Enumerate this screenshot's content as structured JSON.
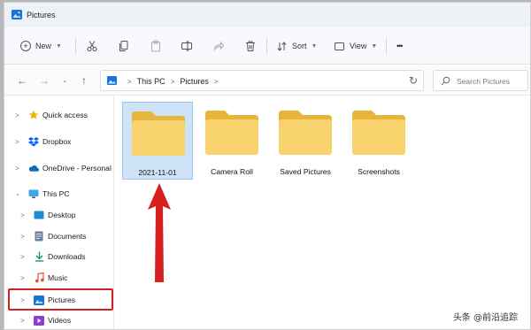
{
  "window": {
    "title": "Pictures"
  },
  "toolbar": {
    "new_label": "New",
    "sort_label": "Sort",
    "view_label": "View",
    "more_label": "•••"
  },
  "address": {
    "crumbs": [
      "This PC",
      "Pictures"
    ],
    "search_placeholder": "Search Pictures"
  },
  "nav": {
    "items": [
      {
        "label": "Quick access",
        "icon": "star-icon"
      },
      {
        "label": "Dropbox",
        "icon": "dropbox-icon"
      },
      {
        "label": "OneDrive - Personal",
        "icon": "cloud-icon"
      },
      {
        "label": "This PC",
        "icon": "monitor-icon"
      },
      {
        "label": "Desktop",
        "icon": "desktop-icon"
      },
      {
        "label": "Documents",
        "icon": "documents-icon"
      },
      {
        "label": "Downloads",
        "icon": "download-icon"
      },
      {
        "label": "Music",
        "icon": "music-icon"
      },
      {
        "label": "Pictures",
        "icon": "pictures-icon"
      },
      {
        "label": "Videos",
        "icon": "videos-icon"
      }
    ]
  },
  "folders": [
    {
      "name": "2021-11-01",
      "selected": true
    },
    {
      "name": "Camera Roll",
      "selected": false
    },
    {
      "name": "Saved Pictures",
      "selected": false
    },
    {
      "name": "Screenshots",
      "selected": false
    }
  ],
  "watermark": "头条 @前沿追踪",
  "colors": {
    "accent": "#0067c0",
    "folder_fill": "#f8d36d",
    "folder_back": "#e8b53c",
    "annotation_red": "#d81f1f",
    "selection": "#cfe3f8"
  }
}
